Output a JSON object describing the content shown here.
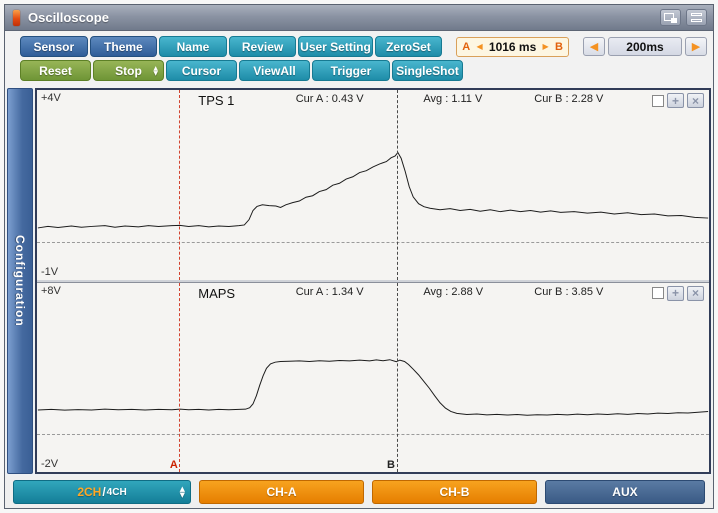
{
  "window": {
    "title": "Oscilloscope"
  },
  "titlebar": {
    "icons": [
      "screen-capture-icon",
      "window-layout-icon"
    ]
  },
  "toolbar": {
    "row1": [
      {
        "label": "Sensor"
      },
      {
        "label": "Theme"
      },
      {
        "label": "Name"
      },
      {
        "label": "Review"
      },
      {
        "label": "User Setting"
      },
      {
        "label": "ZeroSet"
      }
    ],
    "row2": [
      {
        "label": "Reset"
      },
      {
        "label": "Stop"
      },
      {
        "label": "Cursor"
      },
      {
        "label": "ViewAll"
      },
      {
        "label": "Trigger"
      },
      {
        "label": "SingleShot"
      }
    ],
    "delta": {
      "a_label": "A",
      "value": "1016 ms",
      "b_label": "B"
    },
    "timebase": {
      "value": "200ms"
    }
  },
  "sidebar": {
    "label": "Configuration"
  },
  "panels": [
    {
      "name": "TPS 1",
      "vmax_label": "+4V",
      "vmin_label": "-1V",
      "cur_a": "Cur A : 0.43 V",
      "avg": "Avg :  1.11 V",
      "cur_b": "Cur B : 2.28 V"
    },
    {
      "name": "MAPS",
      "vmax_label": "+8V",
      "vmin_label": "-2V",
      "cur_a": "Cur A : 1.34 V",
      "avg": "Avg :  2.88 V",
      "cur_b": "Cur B : 3.85 V"
    }
  ],
  "cursors": {
    "a": {
      "label": "A",
      "x_frac": 0.212,
      "color": "#d24330"
    },
    "b": {
      "label": "B",
      "x_frac": 0.535,
      "color": "#4a4a4a"
    }
  },
  "bottom_bar": {
    "mode_main": "2CH",
    "mode_sep": "/",
    "mode_alt": "4CH",
    "ch_a": "CH-A",
    "ch_b": "CH-B",
    "aux": "AUX"
  },
  "colors": {
    "accent_teal": "#1e8ca8",
    "accent_blue": "#2f5d98",
    "accent_green": "#6f9536",
    "accent_orange": "#e67e00",
    "aux_blue": "#3a5a85",
    "sidebar_blue": "#44699f",
    "cursor_a": "#cc2200",
    "cursor_b": "#222222",
    "trace": "#1c1c1c",
    "panel_bg": "#f5f4f2"
  },
  "chart_data": [
    {
      "type": "line",
      "name": "TPS 1",
      "unit": "V",
      "vmax": 4,
      "vmin": -1,
      "cursor_a_value": 0.43,
      "avg_value": 1.11,
      "cursor_b_value": 2.28,
      "points": [
        [
          0,
          0.36
        ],
        [
          0.015,
          0.4
        ],
        [
          0.03,
          0.37
        ],
        [
          0.05,
          0.41
        ],
        [
          0.065,
          0.38
        ],
        [
          0.08,
          0.4
        ],
        [
          0.1,
          0.42
        ],
        [
          0.115,
          0.38
        ],
        [
          0.13,
          0.41
        ],
        [
          0.15,
          0.39
        ],
        [
          0.165,
          0.42
        ],
        [
          0.18,
          0.4
        ],
        [
          0.2,
          0.42
        ],
        [
          0.212,
          0.43
        ],
        [
          0.225,
          0.4
        ],
        [
          0.24,
          0.42
        ],
        [
          0.255,
          0.39
        ],
        [
          0.27,
          0.41
        ],
        [
          0.285,
          0.4
        ],
        [
          0.3,
          0.42
        ],
        [
          0.308,
          0.44
        ],
        [
          0.315,
          0.58
        ],
        [
          0.321,
          0.82
        ],
        [
          0.327,
          0.93
        ],
        [
          0.335,
          0.97
        ],
        [
          0.345,
          0.95
        ],
        [
          0.355,
          0.94
        ],
        [
          0.362,
          0.9
        ],
        [
          0.37,
          0.97
        ],
        [
          0.38,
          1.03
        ],
        [
          0.39,
          1.07
        ],
        [
          0.4,
          1.17
        ],
        [
          0.41,
          1.21
        ],
        [
          0.42,
          1.32
        ],
        [
          0.43,
          1.37
        ],
        [
          0.44,
          1.49
        ],
        [
          0.45,
          1.54
        ],
        [
          0.46,
          1.65
        ],
        [
          0.47,
          1.71
        ],
        [
          0.48,
          1.82
        ],
        [
          0.49,
          1.87
        ],
        [
          0.5,
          1.97
        ],
        [
          0.51,
          2.05
        ],
        [
          0.52,
          2.11
        ],
        [
          0.527,
          2.21
        ],
        [
          0.533,
          2.26
        ],
        [
          0.537,
          2.35
        ],
        [
          0.542,
          2.2
        ],
        [
          0.548,
          1.85
        ],
        [
          0.554,
          1.45
        ],
        [
          0.56,
          1.18
        ],
        [
          0.568,
          1.0
        ],
        [
          0.576,
          0.92
        ],
        [
          0.585,
          0.88
        ],
        [
          0.6,
          0.84
        ],
        [
          0.615,
          0.87
        ],
        [
          0.63,
          0.82
        ],
        [
          0.645,
          0.85
        ],
        [
          0.66,
          0.8
        ],
        [
          0.675,
          0.84
        ],
        [
          0.69,
          0.79
        ],
        [
          0.705,
          0.83
        ],
        [
          0.72,
          0.79
        ],
        [
          0.735,
          0.82
        ],
        [
          0.75,
          0.78
        ],
        [
          0.765,
          0.81
        ],
        [
          0.78,
          0.77
        ],
        [
          0.8,
          0.79
        ],
        [
          0.82,
          0.75
        ],
        [
          0.84,
          0.78
        ],
        [
          0.86,
          0.73
        ],
        [
          0.88,
          0.76
        ],
        [
          0.9,
          0.71
        ],
        [
          0.92,
          0.73
        ],
        [
          0.94,
          0.68
        ],
        [
          0.96,
          0.69
        ],
        [
          0.98,
          0.64
        ],
        [
          1,
          0.62
        ]
      ]
    },
    {
      "type": "line",
      "name": "MAPS",
      "unit": "V",
      "vmax": 8,
      "vmin": -2,
      "cursor_a_value": 1.34,
      "avg_value": 2.88,
      "cursor_b_value": 3.85,
      "points": [
        [
          0,
          1.3
        ],
        [
          0.02,
          1.33
        ],
        [
          0.04,
          1.29
        ],
        [
          0.06,
          1.32
        ],
        [
          0.08,
          1.3
        ],
        [
          0.1,
          1.34
        ],
        [
          0.12,
          1.31
        ],
        [
          0.14,
          1.33
        ],
        [
          0.16,
          1.3
        ],
        [
          0.18,
          1.33
        ],
        [
          0.2,
          1.31
        ],
        [
          0.212,
          1.34
        ],
        [
          0.225,
          1.31
        ],
        [
          0.24,
          1.33
        ],
        [
          0.255,
          1.3
        ],
        [
          0.27,
          1.33
        ],
        [
          0.285,
          1.31
        ],
        [
          0.3,
          1.33
        ],
        [
          0.31,
          1.34
        ],
        [
          0.316,
          1.42
        ],
        [
          0.321,
          1.62
        ],
        [
          0.326,
          2.05
        ],
        [
          0.331,
          2.6
        ],
        [
          0.336,
          3.1
        ],
        [
          0.341,
          3.5
        ],
        [
          0.347,
          3.73
        ],
        [
          0.354,
          3.82
        ],
        [
          0.362,
          3.86
        ],
        [
          0.375,
          3.87
        ],
        [
          0.39,
          3.89
        ],
        [
          0.405,
          3.86
        ],
        [
          0.42,
          3.9
        ],
        [
          0.435,
          3.87
        ],
        [
          0.45,
          3.91
        ],
        [
          0.465,
          3.89
        ],
        [
          0.48,
          3.93
        ],
        [
          0.495,
          3.89
        ],
        [
          0.505,
          3.94
        ],
        [
          0.515,
          3.9
        ],
        [
          0.525,
          3.95
        ],
        [
          0.532,
          3.88
        ],
        [
          0.535,
          3.85
        ],
        [
          0.54,
          3.93
        ],
        [
          0.547,
          3.86
        ],
        [
          0.553,
          3.7
        ],
        [
          0.56,
          3.45
        ],
        [
          0.568,
          3.15
        ],
        [
          0.576,
          2.8
        ],
        [
          0.584,
          2.45
        ],
        [
          0.592,
          2.05
        ],
        [
          0.6,
          1.68
        ],
        [
          0.608,
          1.4
        ],
        [
          0.616,
          1.22
        ],
        [
          0.625,
          1.12
        ],
        [
          0.64,
          1.06
        ],
        [
          0.655,
          1.09
        ],
        [
          0.67,
          1.04
        ],
        [
          0.685,
          1.07
        ],
        [
          0.7,
          1.03
        ],
        [
          0.715,
          1.06
        ],
        [
          0.73,
          1.02
        ],
        [
          0.745,
          1.05
        ],
        [
          0.76,
          1.03
        ],
        [
          0.775,
          1.07
        ],
        [
          0.79,
          1.04
        ],
        [
          0.805,
          1.08
        ],
        [
          0.82,
          1.05
        ],
        [
          0.835,
          1.09
        ],
        [
          0.85,
          1.06
        ],
        [
          0.865,
          1.1
        ],
        [
          0.88,
          1.07
        ],
        [
          0.895,
          1.11
        ],
        [
          0.91,
          1.09
        ],
        [
          0.925,
          1.13
        ],
        [
          0.94,
          1.11
        ],
        [
          0.955,
          1.15
        ],
        [
          0.97,
          1.14
        ],
        [
          0.985,
          1.18
        ],
        [
          1,
          1.22
        ]
      ]
    }
  ]
}
